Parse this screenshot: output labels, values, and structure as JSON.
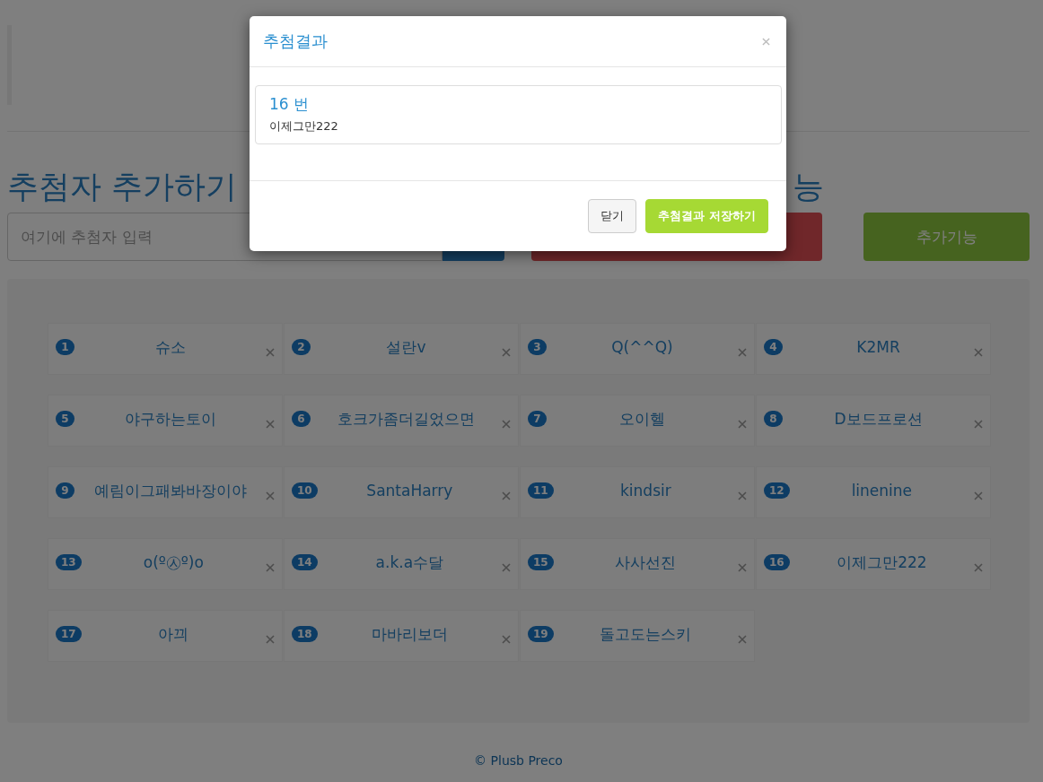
{
  "page": {
    "heading": "추첨자 추가하기",
    "heading_2": "능",
    "input": {
      "placeholder": "여기에 추첨자 입력"
    },
    "extra_button": "추가기능",
    "entries": [
      {
        "number": "1",
        "name": "슈소"
      },
      {
        "number": "2",
        "name": "설란v"
      },
      {
        "number": "3",
        "name": "Q(^^Q)"
      },
      {
        "number": "4",
        "name": "K2MR"
      },
      {
        "number": "5",
        "name": "야구하는토이"
      },
      {
        "number": "6",
        "name": "호크가좀더길었으면"
      },
      {
        "number": "7",
        "name": "오이헬"
      },
      {
        "number": "8",
        "name": "D보드프로션"
      },
      {
        "number": "9",
        "name": "예림이그패봐바장이야"
      },
      {
        "number": "10",
        "name": "SantaHarry"
      },
      {
        "number": "11",
        "name": "kindsir"
      },
      {
        "number": "12",
        "name": "linenine"
      },
      {
        "number": "13",
        "name": "o(º㉦º)o"
      },
      {
        "number": "14",
        "name": "a.k.a수달"
      },
      {
        "number": "15",
        "name": "사사선진"
      },
      {
        "number": "16",
        "name": "이제그만222"
      },
      {
        "number": "17",
        "name": "아끠"
      },
      {
        "number": "18",
        "name": "마바리보더"
      },
      {
        "number": "19",
        "name": "돌고도는스키"
      }
    ],
    "footer": "© Plusb Preco"
  },
  "modal": {
    "title": "추첨결과",
    "result": {
      "number": "16 번",
      "name": "이제그만222"
    },
    "buttons": [
      {
        "label": "닫기",
        "kind": "default"
      },
      {
        "label": "추첨결과 저장하기",
        "kind": "primary"
      }
    ]
  }
}
